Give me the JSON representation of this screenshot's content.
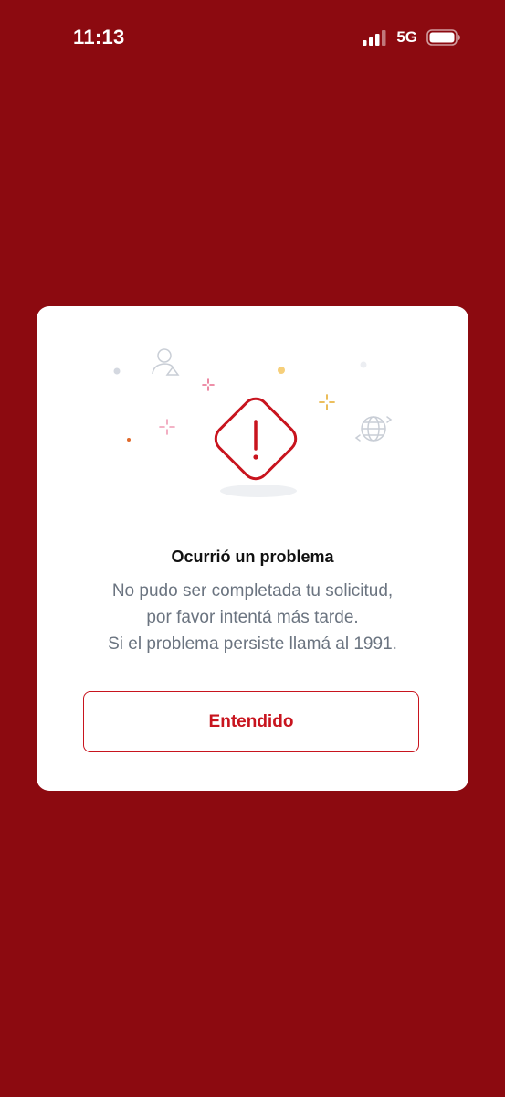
{
  "status_bar": {
    "time": "11:13",
    "network": "5G",
    "signal_icon": "signal-bars-icon",
    "battery_icon": "battery-icon"
  },
  "dialog": {
    "illustration_icon": "warning-diamond-icon",
    "title": "Ocurrió un problema",
    "message_lines": [
      "No pudo ser completada tu solicitud,",
      "por favor intentá más tarde.",
      "Si el problema persiste llamá al 1991."
    ],
    "button_label": "Entendido"
  },
  "colors": {
    "background": "#8c0a10",
    "accent": "#c8141e",
    "card": "#ffffff",
    "message_text": "#6b7480"
  }
}
